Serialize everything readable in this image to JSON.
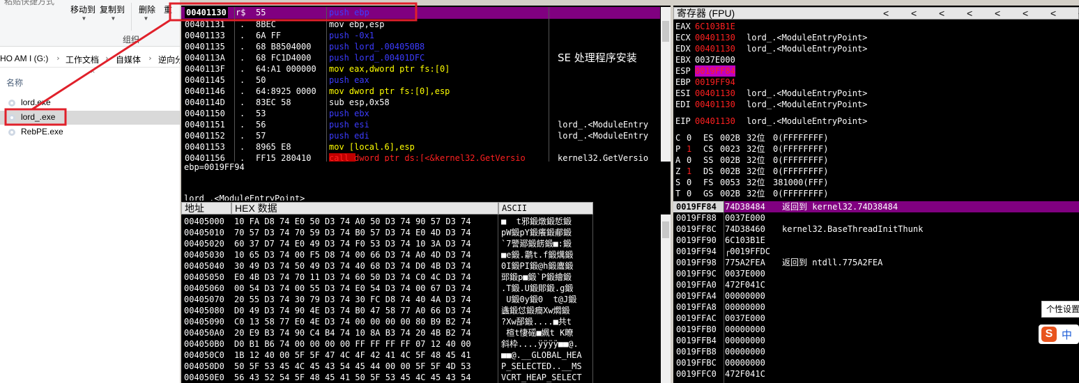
{
  "explorer": {
    "ribbon": {
      "top_cut_text": "粘贴快捷方式",
      "move_to": "移动到",
      "copy_to": "复制到",
      "delete": "删除",
      "rename_cut": "重",
      "group_label": "组织"
    },
    "address": {
      "crumbs": [
        "HO AM I (G:)",
        "工作文档",
        "自媒体",
        "逆向分"
      ]
    },
    "column_name": "名称",
    "files": [
      "lord.exe",
      "lord_.exe",
      "RebPE.exe"
    ]
  },
  "cpu": {
    "toolbar_tail": "",
    "top_address": "00401130",
    "top_marker": "r$",
    "top_hex": "55",
    "top_instr": "push ebp",
    "rows": [
      {
        "addr": "00401131",
        "mk": ".",
        "hex": "8BEC",
        "instr": "mov ebp,esp",
        "instr_color": "white",
        "cmt": ""
      },
      {
        "addr": "00401133",
        "mk": ".",
        "hex": "6A FF",
        "instr": "push -0x1",
        "instr_color": "blue",
        "cmt": ""
      },
      {
        "addr": "00401135",
        "mk": ".",
        "hex": "68 B8504000",
        "instr": "push lord_.004050B8",
        "instr_color": "blue",
        "cmt": ""
      },
      {
        "addr": "0040113A",
        "mk": ".",
        "hex": "68 FC1D4000",
        "instr": "push lord_.00401DFC",
        "instr_color": "blue",
        "cmt": "SE 处理程序安装"
      },
      {
        "addr": "0040113F",
        "mk": ".",
        "hex": "64:A1 000000",
        "instr": "mov eax,dword ptr fs:[0]",
        "instr_color": "yellow",
        "cmt": ""
      },
      {
        "addr": "00401145",
        "mk": ".",
        "hex": "50",
        "instr": "push eax",
        "instr_color": "blue",
        "cmt": ""
      },
      {
        "addr": "00401146",
        "mk": ".",
        "hex": "64:8925 0000",
        "instr": "mov dword ptr fs:[0],esp",
        "instr_color": "yellow",
        "cmt": ""
      },
      {
        "addr": "0040114D",
        "mk": ".",
        "hex": "83EC 58",
        "instr": "sub esp,0x58",
        "instr_color": "white",
        "cmt": ""
      },
      {
        "addr": "00401150",
        "mk": ".",
        "hex": "53",
        "instr": "push ebx",
        "instr_color": "blue",
        "cmt": ""
      },
      {
        "addr": "00401151",
        "mk": ".",
        "hex": "56",
        "instr": "push esi",
        "instr_color": "blue",
        "cmt": "lord_.<ModuleEntry"
      },
      {
        "addr": "00401152",
        "mk": ".",
        "hex": "57",
        "instr": "push edi",
        "instr_color": "blue",
        "cmt": "lord_.<ModuleEntry"
      },
      {
        "addr": "00401153",
        "mk": ".",
        "hex": "8965 E8",
        "instr": "mov [local.6],esp",
        "instr_color": "yellow",
        "cmt": ""
      },
      {
        "addr": "00401156",
        "mk": ".",
        "hex": "FF15 280410",
        "instr": "call dword ptr ds:[<&kernel32.GetVersio",
        "instr_color": "red",
        "cmt": "kernel32.GetVersio"
      }
    ]
  },
  "info_pane": {
    "line1": "ebp=0019FF94",
    "line2": "lord_.<ModuleEntryPoint>"
  },
  "registers": {
    "title": "寄存器 (FPU)",
    "nav_arrows": [
      "<",
      "<",
      "<",
      "<",
      "<",
      "<",
      "<",
      "<"
    ],
    "regs": [
      {
        "name": "EAX",
        "value": "6C103B1E",
        "value_color": "red",
        "desc": ""
      },
      {
        "name": "ECX",
        "value": "00401130",
        "value_color": "red",
        "desc": "lord_.<ModuleEntryPoint>"
      },
      {
        "name": "EDX",
        "value": "00401130",
        "value_color": "red",
        "desc": "lord_.<ModuleEntryPoint>"
      },
      {
        "name": "EBX",
        "value": "0037E000",
        "value_color": "white",
        "desc": ""
      },
      {
        "name": "ESP",
        "value": "0019FF84",
        "value_color": "highlight",
        "desc": ""
      },
      {
        "name": "EBP",
        "value": "0019FF94",
        "value_color": "red",
        "desc": ""
      },
      {
        "name": "ESI",
        "value": "00401130",
        "value_color": "red",
        "desc": "lord_.<ModuleEntryPoint>"
      },
      {
        "name": "EDI",
        "value": "00401130",
        "value_color": "red",
        "desc": "lord_.<ModuleEntryPoint>"
      }
    ],
    "eip": {
      "name": "EIP",
      "value": "00401130",
      "desc": "lord_.<ModuleEntryPoint>"
    },
    "flags": [
      {
        "f": "C",
        "v": "0",
        "seg": "ES",
        "sel": "002B",
        "bits": "32位",
        "base": "0(FFFFFFFF)"
      },
      {
        "f": "P",
        "v": "1",
        "seg": "CS",
        "sel": "0023",
        "bits": "32位",
        "base": "0(FFFFFFFF)"
      },
      {
        "f": "A",
        "v": "0",
        "seg": "SS",
        "sel": "002B",
        "bits": "32位",
        "base": "0(FFFFFFFF)"
      },
      {
        "f": "Z",
        "v": "1",
        "seg": "DS",
        "sel": "002B",
        "bits": "32位",
        "base": "0(FFFFFFFF)"
      },
      {
        "f": "S",
        "v": "0",
        "seg": "FS",
        "sel": "0053",
        "bits": "32位",
        "base": "381000(FFF)"
      },
      {
        "f": "T",
        "v": "0",
        "seg": "GS",
        "sel": "002B",
        "bits": "32位",
        "base": "0(FFFFFFFF)"
      }
    ]
  },
  "dump": {
    "col_addr": "地址",
    "col_hex": "HEX 数据",
    "col_ascii": "ASCII",
    "rows": [
      {
        "a": "00405000",
        "h": "10 FA D8 74 E0 50 D3 74 A0 50 D3 74 90 57 D3 74",
        "s": "■  t邪鍛燉鍛悊鍛"
      },
      {
        "a": "00405010",
        "h": "70 57 D3 74 70 59 D3 74 B0 57 D3 74 E0 4D D3 74",
        "s": "pW鍛pY鍛癢鍛郙鍛"
      },
      {
        "a": "00405020",
        "h": "60 37 D7 74 E0 49 D3 74 F0 53 D3 74 10 3A D3 74",
        "s": "`7譼郔鍛餝鍛■:鍛"
      },
      {
        "a": "00405030",
        "h": "10 65 D3 74 00 F5 D8 74 00 66 D3 74 A0 4D D3 74",
        "s": "■e鍛.鹴t.f鍛燤鍛"
      },
      {
        "a": "00405040",
        "h": "30 49 D3 74 50 49 D3 74 40 68 D3 74 D0 4B D3 74",
        "s": "0I鍛PI鍛@h鍛蠯鍛"
      },
      {
        "a": "00405050",
        "h": "E0 4B D3 74 70 11 D3 74 60 50 D3 74 C0 4C D3 74",
        "s": "郖鍛p■鍛`P鍛繪鍛"
      },
      {
        "a": "00405060",
        "h": "00 54 D3 74 00 55 D3 74 E0 54 D3 74 00 67 D3 74",
        "s": ".T鍛.U鍛郥鍛.g鍛"
      },
      {
        "a": "00405070",
        "h": "20 55 D3 74 30 79 D3 74 30 FC D8 74 40 4A D3 74",
        "s": " U鍛0y鍛0  t@J鍛"
      },
      {
        "a": "00405080",
        "h": "D0 49 D3 74 90 4E D3 74 B0 47 58 77 A0 66 D3 74",
        "s": "蠭鍛怤鍛癎Xw燜鍛"
      },
      {
        "a": "00405090",
        "h": "C0 13 58 77 E0 4E D3 74 00 00 00 00 80 B9 B2 74",
        "s": "?Xw郚鍛....■共t"
      },
      {
        "a": "004050A0",
        "h": "20 E9 B3 74 90 C4 B4 74 10 8A B3 74 20 4B B2 74",
        "s": " 楦t悽磘■姵t K瞭"
      },
      {
        "a": "004050B0",
        "h": "D0 B1 B6 74 00 00 00 00 FF FF FF FF 07 12 40 00",
        "s": "斜枠....ÿÿÿÿ■■@."
      },
      {
        "a": "004050C0",
        "h": "1B 12 40 00 5F 5F 47 4C 4F 42 41 4C 5F 48 45 41",
        "s": "■■@.__GLOBAL_HEA"
      },
      {
        "a": "004050D0",
        "h": "50 5F 53 45 4C 45 43 54 45 44 00 00 5F 5F 4D 53",
        "s": "P_SELECTED..__MS"
      },
      {
        "a": "004050E0",
        "h": "56 43 52 54 5F 48 45 41 50 5F 53 45 4C 45 43 54",
        "s": "VCRT_HEAP_SELECT"
      }
    ]
  },
  "stack": {
    "rows": [
      {
        "a": "0019FF84",
        "v": "74D38484",
        "c": "返回到 kernel32.74D38484",
        "hl": true
      },
      {
        "a": "0019FF88",
        "v": "0037E000",
        "c": "",
        "hl": false
      },
      {
        "a": "0019FF8C",
        "v": "74D38460",
        "c": "kernel32.BaseThreadInitThunk",
        "hl": false
      },
      {
        "a": "0019FF90",
        "v": "6C103B1E",
        "c": "",
        "hl": false
      },
      {
        "a": "0019FF94",
        "v": "┌0019FFDC",
        "c": "",
        "hl": false
      },
      {
        "a": "0019FF98",
        "v": "775A2FEA",
        "c": "返回到 ntdll.775A2FEA",
        "hl": false
      },
      {
        "a": "0019FF9C",
        "v": "0037E000",
        "c": "",
        "hl": false
      },
      {
        "a": "0019FFA0",
        "v": "472F041C",
        "c": "",
        "hl": false
      },
      {
        "a": "0019FFA4",
        "v": "00000000",
        "c": "",
        "hl": false
      },
      {
        "a": "0019FFA8",
        "v": "00000000",
        "c": "",
        "hl": false
      },
      {
        "a": "0019FFAC",
        "v": "0037E000",
        "c": "",
        "hl": false
      },
      {
        "a": "0019FFB0",
        "v": "00000000",
        "c": "",
        "hl": false
      },
      {
        "a": "0019FFB4",
        "v": "00000000",
        "c": "",
        "hl": false
      },
      {
        "a": "0019FFB8",
        "v": "00000000",
        "c": "",
        "hl": false
      },
      {
        "a": "0019FFBC",
        "v": "00000000",
        "c": "",
        "hl": false
      },
      {
        "a": "0019FFC0",
        "v": "472F041C",
        "c": "",
        "hl": false
      }
    ]
  },
  "ime": {
    "tooltip": "个性设置",
    "logo_letter": "S",
    "mode": "中"
  },
  "colors": {
    "highlight_purple": "#800080",
    "annotation_red": "#e0202a"
  }
}
